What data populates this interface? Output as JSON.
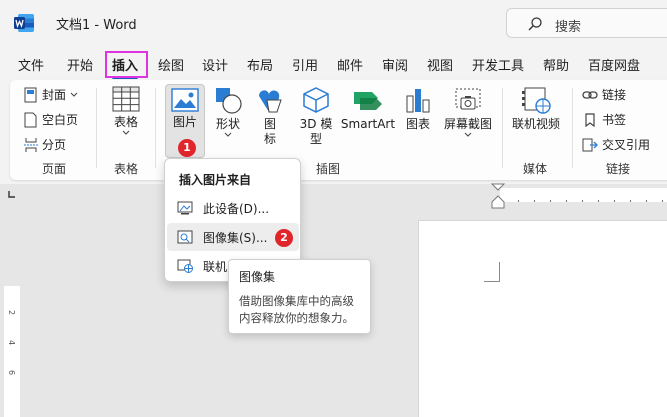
{
  "title_bar": {
    "doc_title": "文档1  -  Word",
    "search_placeholder": "搜索"
  },
  "tabs": [
    {
      "label": "文件"
    },
    {
      "label": "开始"
    },
    {
      "label": "插入"
    },
    {
      "label": "绘图"
    },
    {
      "label": "设计"
    },
    {
      "label": "布局"
    },
    {
      "label": "引用"
    },
    {
      "label": "邮件"
    },
    {
      "label": "审阅"
    },
    {
      "label": "视图"
    },
    {
      "label": "开发工具"
    },
    {
      "label": "帮助"
    },
    {
      "label": "百度网盘"
    }
  ],
  "ribbon": {
    "pages": {
      "cover": "封面",
      "blank": "空白页",
      "break": "分页",
      "group": "页面"
    },
    "tables": {
      "table": "表格",
      "group": "表格"
    },
    "illustrations": {
      "picture_line1": "图片",
      "shapes": "形状",
      "icons_line1": "图",
      "icons_line2": "标",
      "model3d_line1": "3D 模",
      "model3d_line2": "型",
      "smartart": "SmartArt",
      "chart": "图表",
      "screenshot": "屏幕截图",
      "group": "插图"
    },
    "media": {
      "online_video": "联机视频",
      "group": "媒体"
    },
    "links": {
      "link": "链接",
      "bookmark": "书签",
      "cross_ref": "交叉引用",
      "group": "链接"
    }
  },
  "dropdown": {
    "header": "插入图片来自",
    "items": [
      {
        "label": "此设备(D)..."
      },
      {
        "label": "图像集(S)..."
      },
      {
        "label": "联机"
      }
    ]
  },
  "badges": {
    "one": "1",
    "two": "2"
  },
  "tooltip": {
    "title": "图像集",
    "body_line1": "借助图像集库中的高级",
    "body_line2": "内容释放你的想象力。"
  },
  "ruler": {
    "v1": "2",
    "v2": "4",
    "v3": "6"
  },
  "colors": {
    "accent": "#185abd",
    "highlight": "#e033e0",
    "badge": "#e0252b"
  }
}
